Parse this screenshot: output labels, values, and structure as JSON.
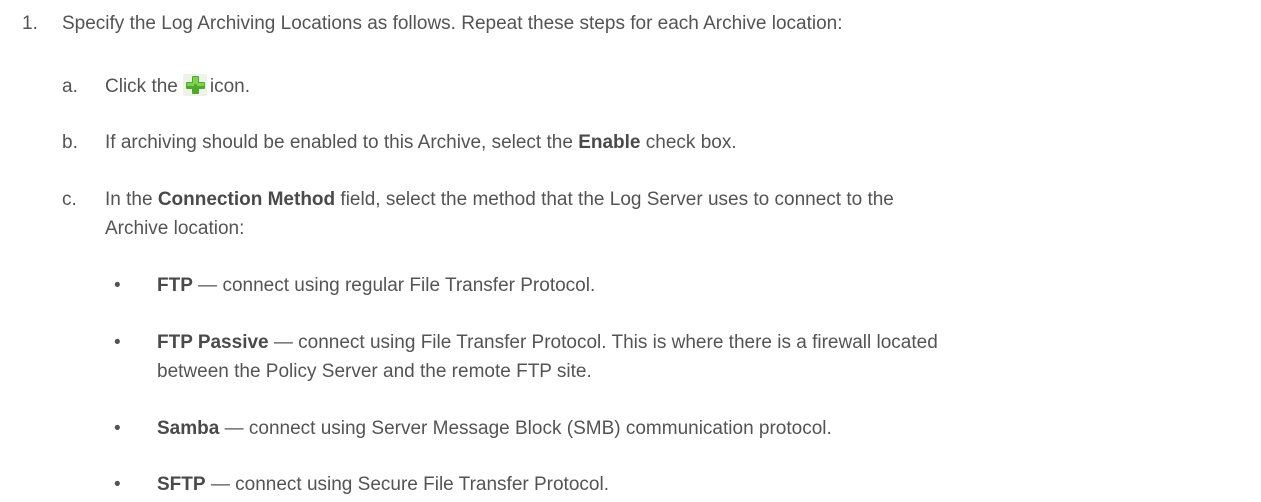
{
  "step": {
    "number": "1.",
    "text": "Specify the Log Archiving Locations as follows. Repeat these steps for each Archive location:"
  },
  "substeps": {
    "a": {
      "letter": "a.",
      "before": "Click the",
      "after": "icon.",
      "icon": "green-plus-icon"
    },
    "b": {
      "letter": "b.",
      "before": "If archiving should be enabled to this Archive, select the",
      "bold": "Enable",
      "after": "check box."
    },
    "c": {
      "letter": "c.",
      "before": "In the",
      "bold": "Connection Method",
      "after_line1": "field, select the method that the Log Server uses to connect to the",
      "line2": "Archive location:"
    }
  },
  "methods": [
    {
      "bullet": "•",
      "name": "FTP",
      "desc": "— connect using regular File Transfer Protocol."
    },
    {
      "bullet": "•",
      "name": "FTP Passive",
      "desc_line1": "— connect using File Transfer Protocol. This is where there is a firewall located",
      "desc_line2": "between the Policy Server and the remote FTP site."
    },
    {
      "bullet": "•",
      "name": "Samba",
      "desc": "— connect using Server Message Block (SMB) communication protocol."
    },
    {
      "bullet": "•",
      "name": "SFTP",
      "desc": "— connect using Secure File Transfer Protocol."
    }
  ],
  "colors": {
    "text": "#545454",
    "icon_green": "#5cb531"
  }
}
